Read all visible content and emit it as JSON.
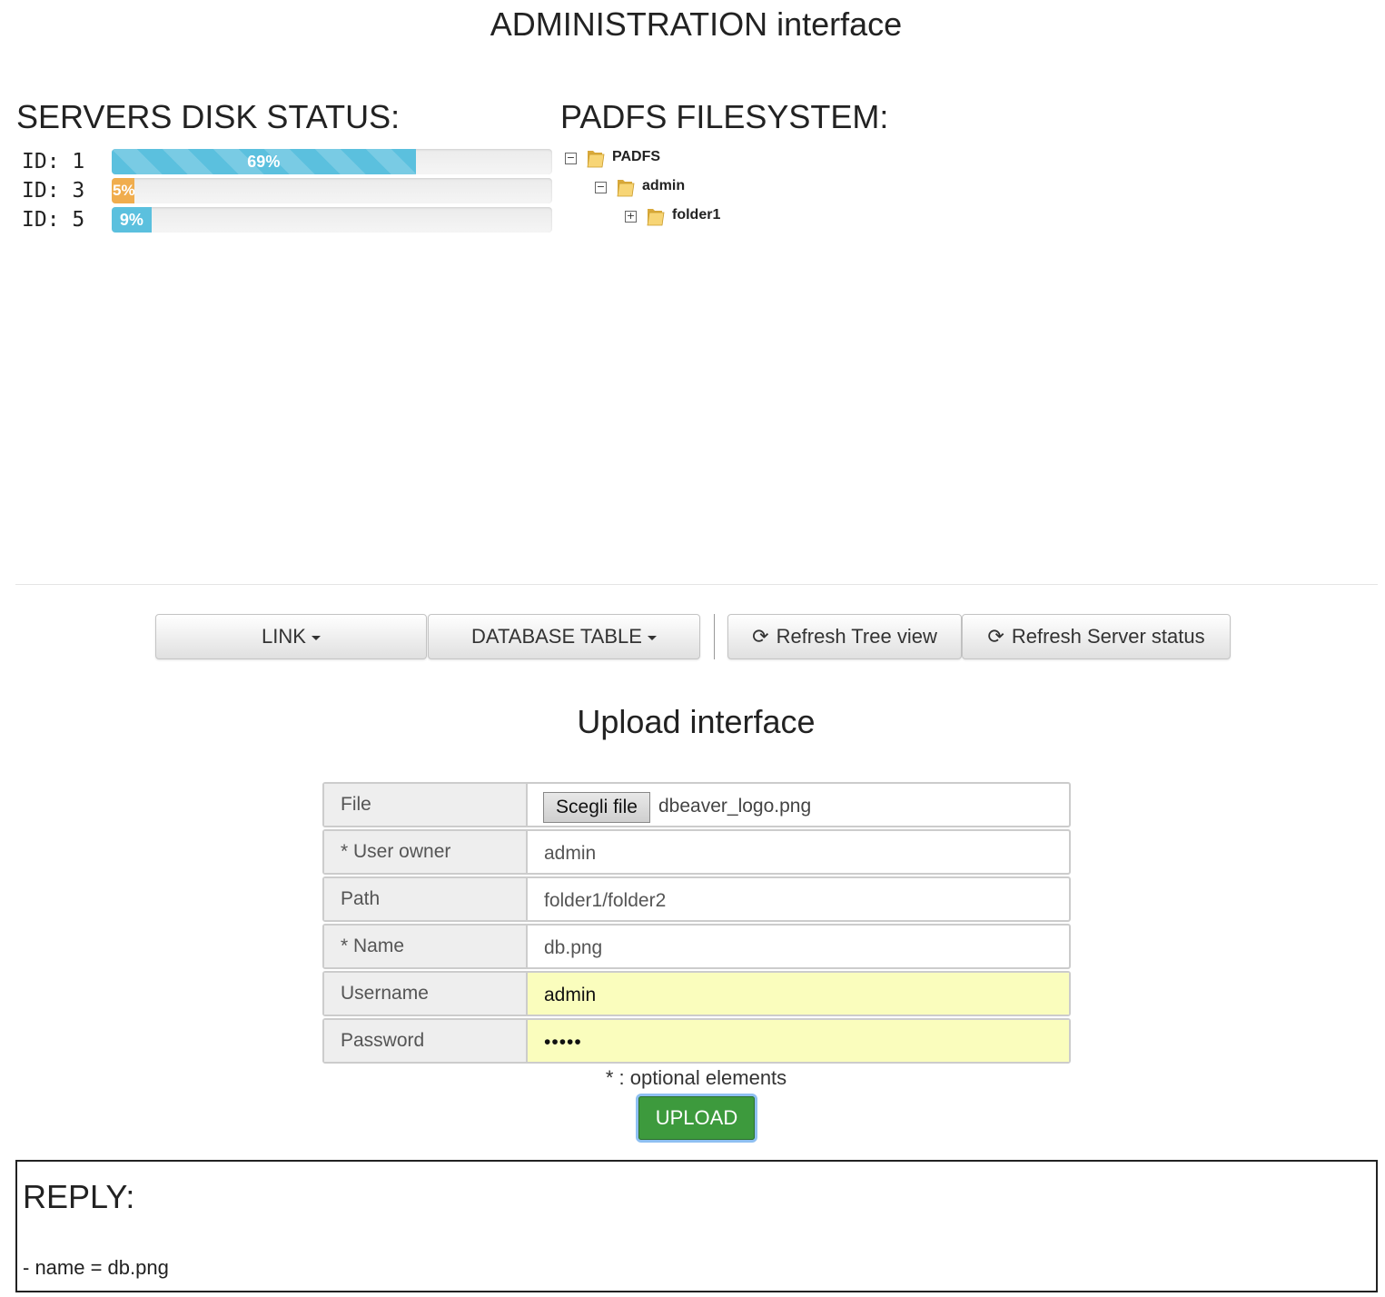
{
  "page_title": "ADMINISTRATION interface",
  "disk_section": {
    "title": "SERVERS DISK STATUS:",
    "servers": [
      {
        "label": "ID: 1",
        "percent_text": "69%",
        "percent": 69
      },
      {
        "label": "ID: 3",
        "percent_text": "5%",
        "percent": 5
      },
      {
        "label": "ID: 5",
        "percent_text": "9%",
        "percent": 9
      }
    ]
  },
  "fs_section": {
    "title": "PADFS FILESYSTEM:",
    "tree": [
      {
        "label": "PADFS",
        "toggle": "−",
        "icon": "folder-icon"
      },
      {
        "label": "admin",
        "toggle": "−",
        "icon": "folder-icon"
      },
      {
        "label": "folder1",
        "toggle": "+",
        "icon": "folder-icon"
      }
    ]
  },
  "toolbar": {
    "link_label": "LINK",
    "db_label": "DATABASE TABLE",
    "refresh_tree_label": "Refresh Tree view",
    "refresh_server_label": "Refresh Server status",
    "refresh_icon": "refresh-icon"
  },
  "upload": {
    "title": "Upload interface",
    "file": {
      "label": "File",
      "button": "Scegli file",
      "filename": "dbeaver_logo.png"
    },
    "user_owner": {
      "label": "* User owner",
      "value": "admin"
    },
    "path": {
      "label": "Path",
      "value": "folder1/folder2"
    },
    "name": {
      "label": "* Name",
      "value": "db.png"
    },
    "username": {
      "label": "Username",
      "value": "admin"
    },
    "password": {
      "label": "Password",
      "value": "•••••"
    },
    "note": "* : optional elements",
    "button": "UPLOAD",
    "autofill_color": "#fafdbd",
    "button_color": "#3d9a3d"
  },
  "reply": {
    "title": "REPLY:",
    "body": "- name = db.png"
  }
}
